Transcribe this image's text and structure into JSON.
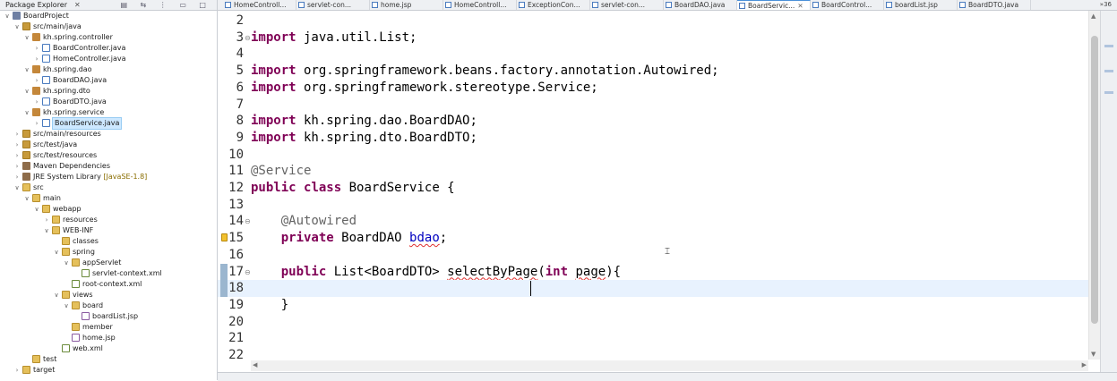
{
  "explorer": {
    "title": "Package Explorer",
    "close_glyph": "✕",
    "toolbar_glyphs": "▤ ⇆ ⋮ ▭ □",
    "items": [
      {
        "label": "BoardProject",
        "arrow": "∨",
        "icon": "project",
        "level": 0
      },
      {
        "label": "src/main/java",
        "arrow": "∨",
        "icon": "srcfolder",
        "level": 1
      },
      {
        "label": "kh.spring.controller",
        "arrow": "∨",
        "icon": "package",
        "level": 2
      },
      {
        "label": "BoardController.java",
        "arrow": "›",
        "icon": "java",
        "level": 3
      },
      {
        "label": "HomeController.java",
        "arrow": "›",
        "icon": "java",
        "level": 3
      },
      {
        "label": "kh.spring.dao",
        "arrow": "∨",
        "icon": "package",
        "level": 2
      },
      {
        "label": "BoardDAO.java",
        "arrow": "›",
        "icon": "java",
        "level": 3
      },
      {
        "label": "kh.spring.dto",
        "arrow": "∨",
        "icon": "package",
        "level": 2
      },
      {
        "label": "BoardDTO.java",
        "arrow": "›",
        "icon": "java",
        "level": 3
      },
      {
        "label": "kh.spring.service",
        "arrow": "∨",
        "icon": "package",
        "level": 2
      },
      {
        "label": "BoardService.java",
        "arrow": "›",
        "icon": "java",
        "level": 3,
        "selected": true
      },
      {
        "label": "src/main/resources",
        "arrow": "›",
        "icon": "srcfolder",
        "level": 1
      },
      {
        "label": "src/test/java",
        "arrow": "›",
        "icon": "srcfolder",
        "level": 1
      },
      {
        "label": "src/test/resources",
        "arrow": "›",
        "icon": "srcfolder",
        "level": 1
      },
      {
        "label": "Maven Dependencies",
        "arrow": "›",
        "icon": "lib",
        "level": 1
      },
      {
        "label": "JRE System Library",
        "decor": "[JavaSE-1.8]",
        "arrow": "›",
        "icon": "lib",
        "level": 1
      },
      {
        "label": "src",
        "arrow": "∨",
        "icon": "folder",
        "level": 1
      },
      {
        "label": "main",
        "arrow": "∨",
        "icon": "folder",
        "level": 2
      },
      {
        "label": "webapp",
        "arrow": "∨",
        "icon": "folder",
        "level": 3
      },
      {
        "label": "resources",
        "arrow": "›",
        "icon": "folder",
        "level": 4
      },
      {
        "label": "WEB-INF",
        "arrow": "∨",
        "icon": "folder",
        "level": 4
      },
      {
        "label": "classes",
        "arrow": "",
        "icon": "folder",
        "level": 5
      },
      {
        "label": "spring",
        "arrow": "∨",
        "icon": "folder",
        "level": 5
      },
      {
        "label": "appServlet",
        "arrow": "∨",
        "icon": "folder",
        "level": 6
      },
      {
        "label": "servlet-context.xml",
        "arrow": "",
        "icon": "xml",
        "level": 7
      },
      {
        "label": "root-context.xml",
        "arrow": "",
        "icon": "xml",
        "level": 6
      },
      {
        "label": "views",
        "arrow": "∨",
        "icon": "folder",
        "level": 5
      },
      {
        "label": "board",
        "arrow": "∨",
        "icon": "folder",
        "level": 6
      },
      {
        "label": "boardList.jsp",
        "arrow": "",
        "icon": "jsp",
        "level": 7
      },
      {
        "label": "member",
        "arrow": "",
        "icon": "folder",
        "level": 6
      },
      {
        "label": "home.jsp",
        "arrow": "",
        "icon": "jsp",
        "level": 6
      },
      {
        "label": "web.xml",
        "arrow": "",
        "icon": "xml",
        "level": 5
      },
      {
        "label": "test",
        "arrow": "",
        "icon": "folder",
        "level": 2
      },
      {
        "label": "target",
        "arrow": "›",
        "icon": "folder",
        "level": 1
      }
    ]
  },
  "editor": {
    "tabs": [
      {
        "label": "HomeControll...",
        "icon": "java"
      },
      {
        "label": "servlet-con...",
        "icon": "xml"
      },
      {
        "label": "home.jsp",
        "icon": "jsp"
      },
      {
        "label": "HomeControll...",
        "icon": "java"
      },
      {
        "label": "ExceptionCon...",
        "icon": "java"
      },
      {
        "label": "servlet-con...",
        "icon": "xml"
      },
      {
        "label": "BoardDAO.java",
        "icon": "java"
      },
      {
        "label": "BoardServic...",
        "icon": "java",
        "active": true,
        "close": "✕"
      },
      {
        "label": "BoardControl...",
        "icon": "java"
      },
      {
        "label": "boardList.jsp",
        "icon": "jsp"
      },
      {
        "label": "BoardDTO.java",
        "icon": "java"
      }
    ],
    "tab_overflow": "»36",
    "current_line": "18",
    "lines": [
      {
        "num": "2",
        "segments": []
      },
      {
        "num": "3",
        "fold": "⊖",
        "segments": [
          {
            "t": "import",
            "c": "kw"
          },
          {
            "t": " java.util.List;"
          }
        ]
      },
      {
        "num": "4",
        "segments": []
      },
      {
        "num": "5",
        "segments": [
          {
            "t": "import",
            "c": "kw"
          },
          {
            "t": " org.springframework.beans.factory.annotation.Autowired;"
          }
        ]
      },
      {
        "num": "6",
        "segments": [
          {
            "t": "import",
            "c": "kw"
          },
          {
            "t": " org.springframework.stereotype.Service;"
          }
        ]
      },
      {
        "num": "7",
        "segments": []
      },
      {
        "num": "8",
        "segments": [
          {
            "t": "import",
            "c": "kw"
          },
          {
            "t": " kh.spring.dao.BoardDAO;"
          }
        ]
      },
      {
        "num": "9",
        "segments": [
          {
            "t": "import",
            "c": "kw"
          },
          {
            "t": " kh.spring.dto.BoardDTO;"
          }
        ]
      },
      {
        "num": "10",
        "segments": []
      },
      {
        "num": "11",
        "segments": [
          {
            "t": "@Service",
            "c": "ann"
          }
        ]
      },
      {
        "num": "12",
        "segments": [
          {
            "t": "public",
            "c": "kw"
          },
          {
            "t": " "
          },
          {
            "t": "class",
            "c": "kw"
          },
          {
            "t": " BoardService {"
          }
        ]
      },
      {
        "num": "13",
        "segments": []
      },
      {
        "num": "14",
        "fold": "⊖",
        "segments": [
          {
            "t": "    "
          },
          {
            "t": "@Autowired",
            "c": "ann"
          }
        ]
      },
      {
        "num": "15",
        "marker": "warn",
        "segments": [
          {
            "t": "    "
          },
          {
            "t": "private",
            "c": "kw"
          },
          {
            "t": " BoardDAO "
          },
          {
            "t": "bdao",
            "c": "fld squig"
          },
          {
            "t": ";"
          }
        ]
      },
      {
        "num": "16",
        "segments": []
      },
      {
        "num": "17",
        "marker": "override",
        "fold": "⊖",
        "segments": [
          {
            "t": "    "
          },
          {
            "t": "public",
            "c": "kw"
          },
          {
            "t": " List<BoardDTO> "
          },
          {
            "t": "selectByPage",
            "c": "squig"
          },
          {
            "t": "("
          },
          {
            "t": "int",
            "c": "kw"
          },
          {
            "t": " "
          },
          {
            "t": "page",
            "c": "squig"
          },
          {
            "t": "){"
          }
        ]
      },
      {
        "num": "18",
        "segments": []
      },
      {
        "num": "19",
        "segments": [
          {
            "t": "    }"
          }
        ]
      },
      {
        "num": "20",
        "segments": []
      },
      {
        "num": "21",
        "segments": []
      },
      {
        "num": "22",
        "segments": []
      }
    ]
  },
  "scroll": {
    "up": "▲",
    "down": "▼",
    "left": "◀",
    "right": "▶"
  },
  "colors": {
    "keyword": "#7f0055",
    "annotation": "#646464",
    "field": "#0000c0",
    "current_line": "#e8f2fe"
  }
}
